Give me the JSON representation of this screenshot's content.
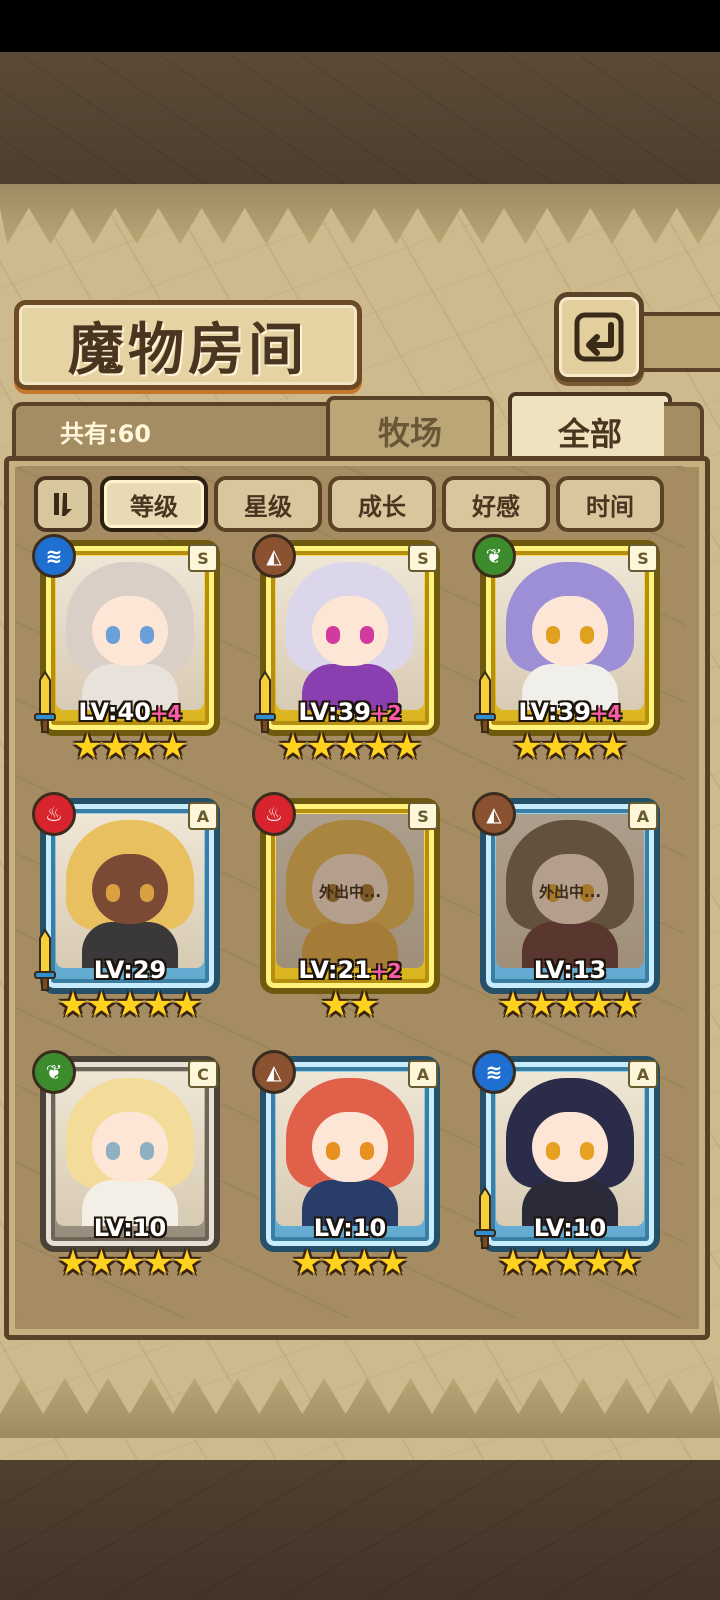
{
  "title": "魔物房间",
  "count_label": "共有:60",
  "tabs": [
    {
      "label": "牧场",
      "active": false
    },
    {
      "label": "全部",
      "active": true
    }
  ],
  "filters": [
    {
      "label": "等级",
      "active": true
    },
    {
      "label": "星级",
      "active": false
    },
    {
      "label": "成长",
      "active": false
    },
    {
      "label": "好感",
      "active": false
    },
    {
      "label": "时间",
      "active": false
    }
  ],
  "monsters": [
    {
      "element": "water",
      "rank": "S",
      "frame": "gold",
      "level": "LV:40",
      "bonus": "+4",
      "stars": 4,
      "away_text": "",
      "hair": "#d9cfc6",
      "body": "#e8e2da",
      "eye": "#6aa0d8",
      "sword": true
    },
    {
      "element": "earth",
      "rank": "S",
      "frame": "gold",
      "level": "LV:39",
      "bonus": "+2",
      "stars": 5,
      "away_text": "",
      "hair": "#dcd6ea",
      "body": "#8a3fb0",
      "eye": "#d23aa0",
      "sword": true
    },
    {
      "element": "grass",
      "rank": "S",
      "frame": "gold",
      "level": "LV:39",
      "bonus": "+4",
      "stars": 4,
      "away_text": "",
      "hair": "#9d8fd6",
      "body": "#f1efe9",
      "eye": "#e0a020",
      "sword": true
    },
    {
      "element": "fire",
      "rank": "A",
      "frame": "blue",
      "level": "LV:29",
      "bonus": "",
      "stars": 5,
      "away_text": "",
      "hair": "#e8c060",
      "body": "#3a3838",
      "eye": "#d8a040",
      "sword": true
    },
    {
      "element": "fire",
      "rank": "S",
      "frame": "gold",
      "level": "LV:21",
      "bonus": "+2",
      "stars": 2,
      "away_text": "外出中...",
      "hair": "#e9b84a",
      "body": "#e2a63c",
      "eye": "#9a6a20",
      "sword": false
    },
    {
      "element": "earth",
      "rank": "A",
      "frame": "blue",
      "level": "LV:13",
      "bonus": "",
      "stars": 5,
      "away_text": "外出中...",
      "hair": "#6b5a48",
      "body": "#5a2a2a",
      "eye": "#e0a020",
      "sword": false
    },
    {
      "element": "grass",
      "rank": "C",
      "frame": "silver",
      "level": "LV:10",
      "bonus": "",
      "stars": 5,
      "away_text": "",
      "hair": "#f3dc9a",
      "body": "#f4efe6",
      "eye": "#8fb0c0",
      "sword": false
    },
    {
      "element": "earth",
      "rank": "A",
      "frame": "blue",
      "level": "LV:10",
      "bonus": "",
      "stars": 4,
      "away_text": "",
      "hair": "#e0604a",
      "body": "#2a3c68",
      "eye": "#e89020",
      "sword": false
    },
    {
      "element": "water",
      "rank": "A",
      "frame": "blue",
      "level": "LV:10",
      "bonus": "",
      "stars": 5,
      "away_text": "",
      "hair": "#2a2c4a",
      "body": "#2a2a38",
      "eye": "#e8a020",
      "sword": true
    }
  ],
  "colors": {
    "water": "#1f6fd1",
    "earth": "#8a5230",
    "grass": "#3c8c2e",
    "fire": "#d8242c",
    "star": "#ffd21f",
    "bonus": "#ff5ca8"
  }
}
